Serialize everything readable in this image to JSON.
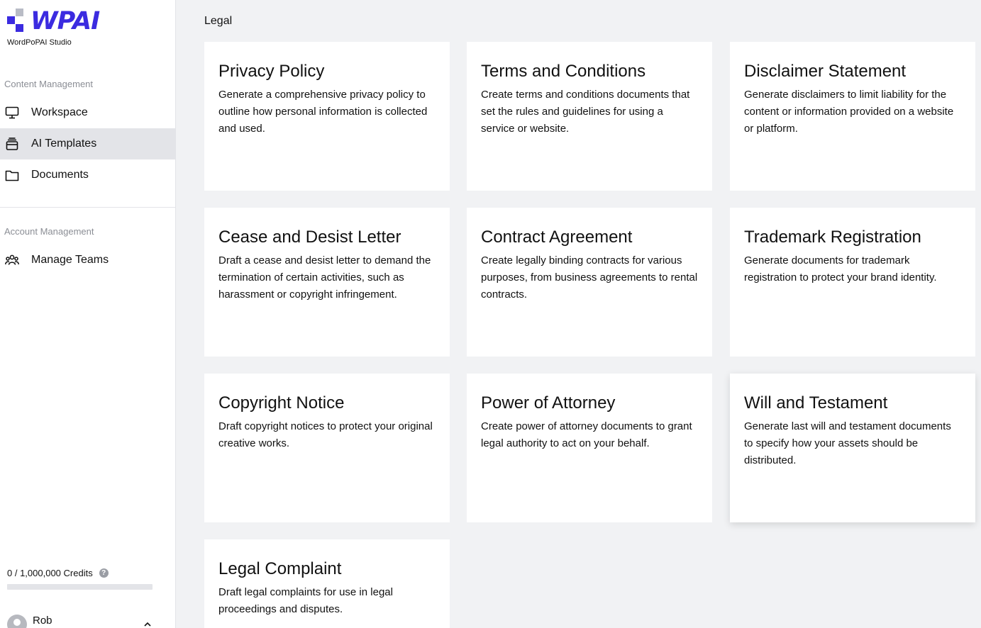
{
  "brand": {
    "logo_text": "WPAI",
    "studio_name": "WordPoPAI Studio",
    "accent": "#3b2be0"
  },
  "sidebar": {
    "content_section": "Content Management",
    "content_items": [
      {
        "label": "Workspace",
        "icon": "monitor-icon"
      },
      {
        "label": "AI Templates",
        "icon": "stack-icon",
        "active": true
      },
      {
        "label": "Documents",
        "icon": "folder-icon"
      }
    ],
    "account_section": "Account Management",
    "account_items": [
      {
        "label": "Manage Teams",
        "icon": "team-icon"
      }
    ],
    "credits_text": "0 / 1,000,000 Credits",
    "credits_used_fraction": 0,
    "user_name": "Rob"
  },
  "main": {
    "breadcrumb": "Legal",
    "cards": [
      {
        "title": "Privacy Policy",
        "desc": "Generate a comprehensive privacy policy to outline how personal information is collected and used."
      },
      {
        "title": "Terms and Conditions",
        "desc": "Create terms and conditions documents that set the rules and guidelines for using a service or website."
      },
      {
        "title": "Disclaimer Statement",
        "desc": "Generate disclaimers to limit liability for the content or information provided on a website or platform."
      },
      {
        "title": "Cease and Desist Letter",
        "desc": "Draft a cease and desist letter to demand the termination of certain activities, such as harassment or copyright infringement."
      },
      {
        "title": "Contract Agreement",
        "desc": "Create legally binding contracts for various purposes, from business agreements to rental contracts."
      },
      {
        "title": "Trademark Registration",
        "desc": "Generate documents for trademark registration to protect your brand identity."
      },
      {
        "title": "Copyright Notice",
        "desc": "Draft copyright notices to protect your original creative works."
      },
      {
        "title": "Power of Attorney",
        "desc": "Create power of attorney documents to grant legal authority to act on your behalf."
      },
      {
        "title": "Will and Testament",
        "desc": "Generate last will and testament documents to specify how your assets should be distributed."
      },
      {
        "title": "Legal Complaint",
        "desc": "Draft legal complaints for use in legal proceedings and disputes."
      }
    ]
  }
}
